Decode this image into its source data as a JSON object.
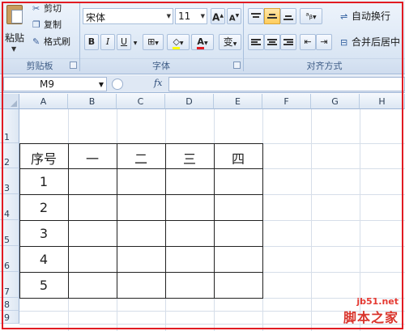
{
  "ribbon": {
    "clipboard": {
      "paste_label": "粘贴",
      "cut_label": "剪切",
      "copy_label": "复制",
      "format_painter_label": "格式刷",
      "group_label": "剪贴板"
    },
    "font": {
      "font_name": "宋体",
      "font_size": "11",
      "bold": "B",
      "italic": "I",
      "underline": "U",
      "grow_font": "A",
      "shrink_font": "A",
      "font_color_letter": "A",
      "phonetic": "变",
      "group_label": "字体",
      "font_color": "#e11b22",
      "fill_color": "#ffff00"
    },
    "alignment": {
      "wrap_text_label": "自动换行",
      "merge_center_label": "合并后居中",
      "group_label": "对齐方式"
    }
  },
  "formula_bar": {
    "name_box": "M9",
    "fx_label": "fx",
    "formula": ""
  },
  "grid": {
    "columns": [
      "A",
      "B",
      "C",
      "D",
      "E",
      "F",
      "G",
      "H"
    ],
    "rows": [
      "1",
      "2",
      "3",
      "4",
      "5",
      "6",
      "7",
      "8",
      "9"
    ],
    "table": {
      "header": [
        "序号",
        "一",
        "二",
        "三",
        "四"
      ],
      "index": [
        "1",
        "2",
        "3",
        "4",
        "5"
      ]
    }
  },
  "watermark": {
    "url": "jb51.net",
    "name": "脚本之家"
  }
}
